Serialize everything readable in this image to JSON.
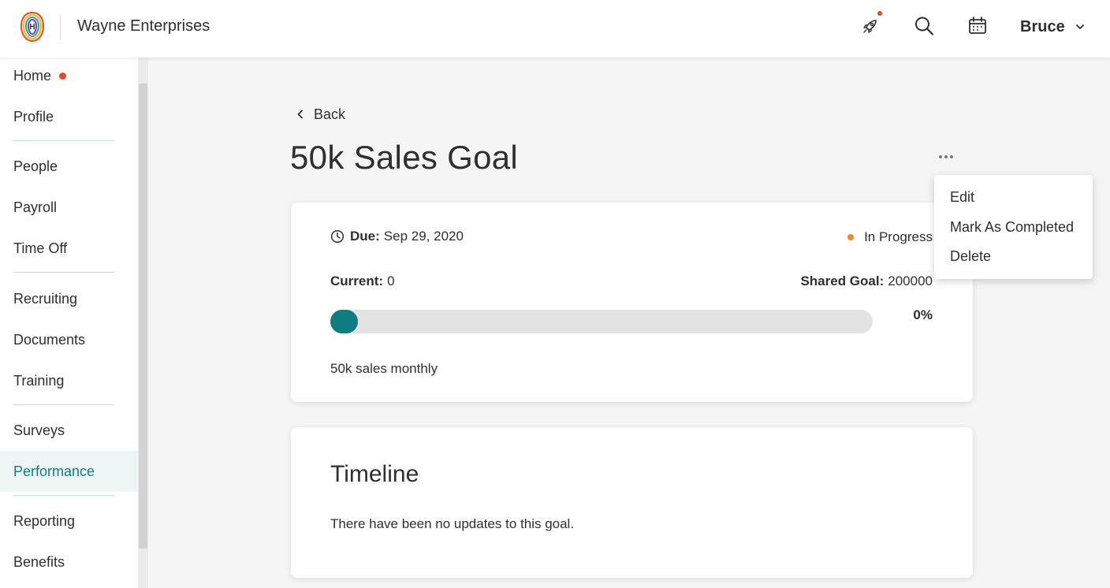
{
  "header": {
    "company": "Wayne Enterprises",
    "logo_icon": "logo-h-icon",
    "icons": [
      "rocket-icon",
      "search-icon",
      "calendar-icon"
    ],
    "user_name": "Bruce",
    "notification_color": "#e8491d"
  },
  "sidebar": {
    "items": [
      {
        "label": "Home",
        "notification": true
      },
      {
        "label": "Profile"
      },
      {
        "label": "People"
      },
      {
        "label": "Payroll"
      },
      {
        "label": "Time Off"
      },
      {
        "label": "Recruiting"
      },
      {
        "label": "Documents"
      },
      {
        "label": "Training"
      },
      {
        "label": "Surveys"
      },
      {
        "label": "Performance",
        "active": true
      },
      {
        "label": "Reporting"
      },
      {
        "label": "Benefits"
      }
    ],
    "accent_color": "#0f7c82"
  },
  "main": {
    "back_label": "Back",
    "title": "50k Sales Goal",
    "goal": {
      "due_label": "Due:",
      "due_date": "Sep 29, 2020",
      "status": "In Progress",
      "status_color": "#e98a2a",
      "current_label": "Current:",
      "current_value": "0",
      "shared_goal_label": "Shared Goal:",
      "shared_goal_value": "200000",
      "progress_percent": "0%",
      "progress_fraction": 0,
      "description": "50k sales monthly"
    },
    "timeline": {
      "title": "Timeline",
      "empty_text": "There have been no updates to this goal."
    }
  },
  "dropdown": {
    "items": [
      "Edit",
      "Mark As Completed",
      "Delete"
    ]
  }
}
